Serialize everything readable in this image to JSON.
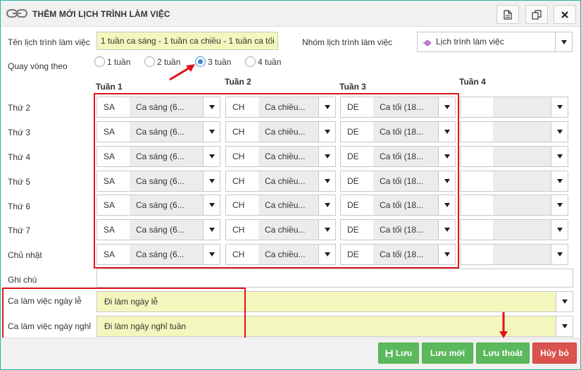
{
  "window": {
    "title": "THÊM MỚI LỊCH TRÌNH LÀM VIỆC",
    "title_icon": "link-chain-icon",
    "toolbar_icons": [
      "document-icon",
      "copy-icon",
      "close-icon"
    ]
  },
  "form": {
    "schedule_name_label": "Tên lịch trình làm việc",
    "schedule_name_value": "1 tuần ca sáng - 1 tuần ca chiều - 1 tuần ca tối",
    "group_label": "Nhóm lịch trình làm việc",
    "group_value": "Lịch trình làm việc",
    "rotation_label": "Quay vòng theo",
    "rotation_options": [
      "1 tuần",
      "2 tuần",
      "3 tuần",
      "4 tuần"
    ],
    "rotation_selected": "3 tuần",
    "note_label": "Ghi chú",
    "note_value": "",
    "holiday_label": "Ca làm việc ngày lễ",
    "holiday_value": "Đi làm ngày lễ",
    "dayoff_label": "Ca làm việc ngày nghỉ",
    "dayoff_value": "Đi làm ngày nghỉ tuần"
  },
  "weeks": [
    "Tuần 1",
    "Tuần 2",
    "Tuần 3",
    "Tuần 4"
  ],
  "days": [
    "Thứ 2",
    "Thứ 3",
    "Thứ 4",
    "Thứ 5",
    "Thứ 6",
    "Thứ 7",
    "Chủ nhật"
  ],
  "week_cells": [
    {
      "code": "SA",
      "name": "Ca sáng (6..."
    },
    {
      "code": "CH",
      "name": "Ca chiều..."
    },
    {
      "code": "DE",
      "name": "Ca tối (18..."
    },
    {
      "code": "",
      "name": ""
    }
  ],
  "buttons": {
    "save": "Lưu",
    "save_new": "Lưu mới",
    "save_exit": "Lưu thoát",
    "cancel": "Hủy bỏ"
  },
  "colors": {
    "accent": "#20b6a0",
    "highlight_red": "#e0141b",
    "input_yellow": "#f4f7bd",
    "button_green": "#5cb85c",
    "button_red": "#d9534f"
  }
}
